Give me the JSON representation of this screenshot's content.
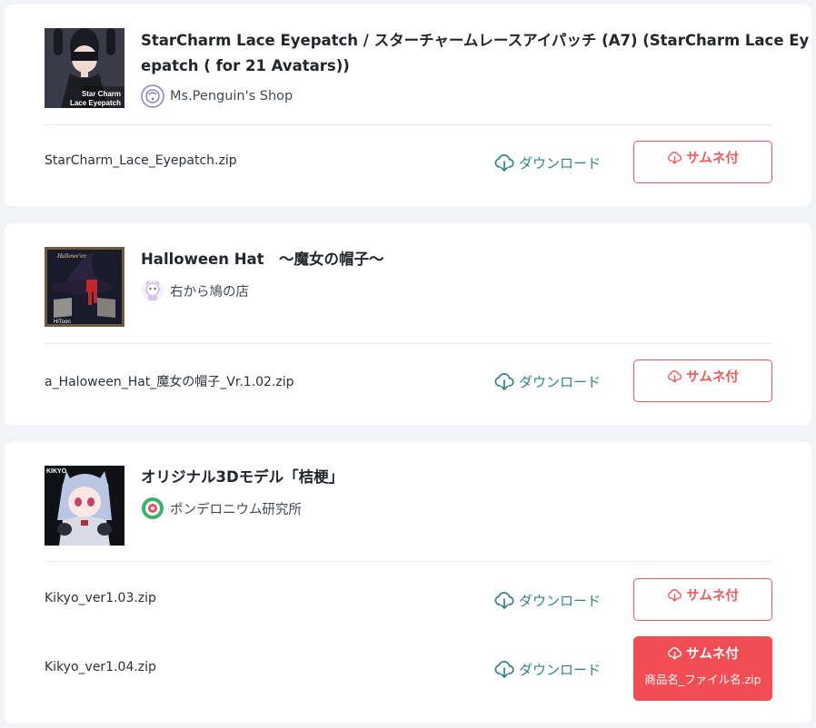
{
  "items": [
    {
      "title": "StarCharm Lace Eyepatch / スターチャームレースアイパッチ (A7) (StarCharm Lace Eyepatch ( for 21 Avatars))",
      "title_line1": "StarCharm Lace Eyepatch / スターチャームレースアイパッチ (A7) (StarCharm Lace Ey",
      "title_line2": "epatch ( for 21 Avatars))",
      "thumbnail_caption_1": "Star Charm",
      "thumbnail_caption_2": "Lace Eyepatch",
      "shop_name": "Ms.Penguin's Shop",
      "files": [
        {
          "filename": "StarCharm_Lace_Eyepatch.zip",
          "download_label": "ダウンロード",
          "thumb_button_label": "サムネ付"
        }
      ]
    },
    {
      "title": "Halloween Hat　～魔女の帽子～",
      "thumbnail_caption_1": "Hallowe'en",
      "thumbnail_caption_2": "HiToon",
      "shop_name": "右から鳩の店",
      "files": [
        {
          "filename": "a_Haloween_Hat_魔女の帽子_Vr.1.02.zip",
          "download_label": "ダウンロード",
          "thumb_button_label": "サムネ付"
        }
      ]
    },
    {
      "title": "オリジナル3Dモデル「桔梗」",
      "thumbnail_caption_1": "KIKYO",
      "shop_name": "ポンデロニウム研究所",
      "files": [
        {
          "filename": "Kikyo_ver1.03.zip",
          "download_label": "ダウンロード",
          "thumb_button_label": "サムネ付"
        },
        {
          "filename": "Kikyo_ver1.04.zip",
          "download_label": "ダウンロード",
          "thumb_button_label": "サムネ付",
          "thumb_button_sublabel": "商品名_ファイル名.zip",
          "thumb_button_state": "hover"
        }
      ]
    }
  ],
  "colors": {
    "page_bg": "#f1f3f6",
    "card_bg": "#ffffff",
    "download_link": "#2f8383",
    "accent_red": "#ef5a5a",
    "accent_red_filled": "#f34d54"
  },
  "icons": {
    "download": "cloud-download-icon",
    "thumbnail_download": "cloud-download-icon"
  }
}
